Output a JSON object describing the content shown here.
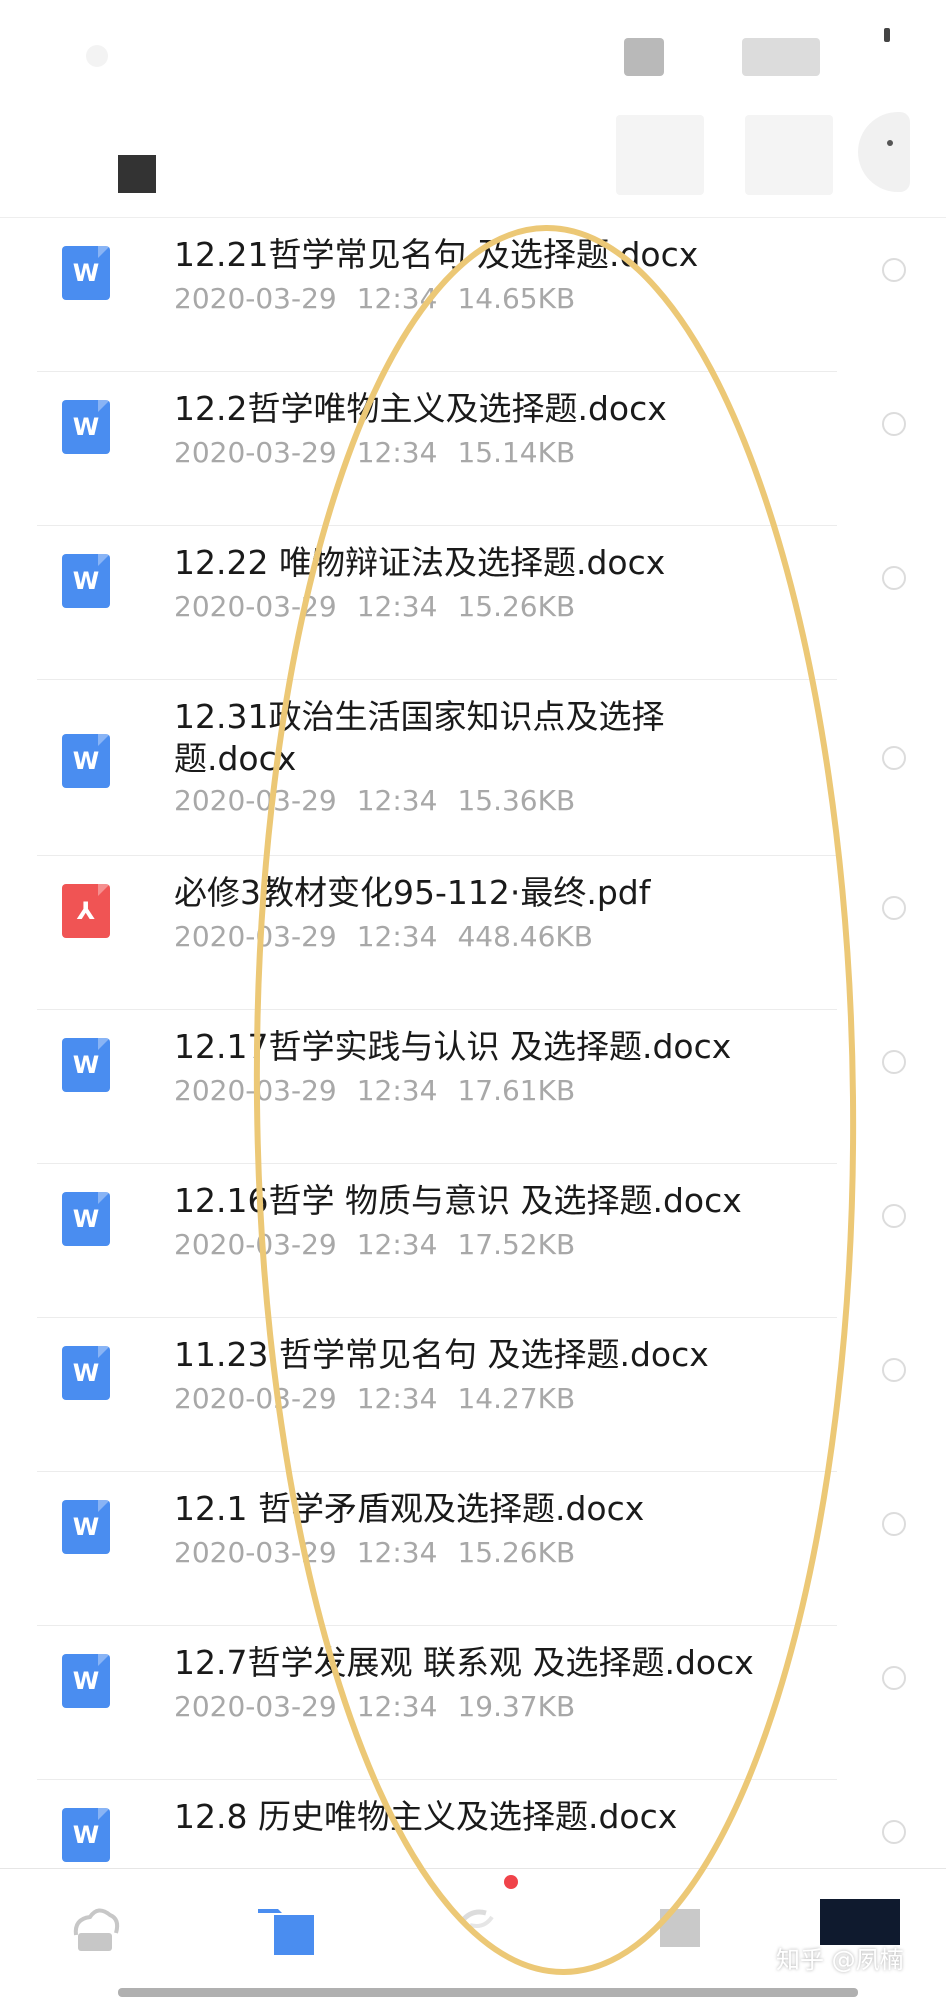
{
  "colors": {
    "docx_icon": "#4a8df0",
    "pdf_icon": "#f05454",
    "file_name": "#1a1a1a",
    "file_meta": "#a8a8a8",
    "highlight": "#ecc876",
    "tab_active": "#4a8df0",
    "badge": "#f0434a"
  },
  "header": {
    "back_icon": "back-icon"
  },
  "files": [
    {
      "name": "12.21哲学常见名句 及选择题.docx",
      "date": "2020-03-29",
      "time": "12:34",
      "size": "14.65KB",
      "type": "docx",
      "icon_glyph": "W"
    },
    {
      "name": "12.2哲学唯物主义及选择题.docx",
      "date": "2020-03-29",
      "time": "12:34",
      "size": "15.14KB",
      "type": "docx",
      "icon_glyph": "W"
    },
    {
      "name": "12.22 唯物辩证法及选择题.docx",
      "date": "2020-03-29",
      "time": "12:34",
      "size": "15.26KB",
      "type": "docx",
      "icon_glyph": "W"
    },
    {
      "name": "12.31政治生活国家知识点及选择题.docx",
      "date": "2020-03-29",
      "time": "12:34",
      "size": "15.36KB",
      "type": "docx",
      "icon_glyph": "W"
    },
    {
      "name": "必修3教材变化95-112·最终.pdf",
      "date": "2020-03-29",
      "time": "12:34",
      "size": "448.46KB",
      "type": "pdf",
      "icon_glyph": "⅄"
    },
    {
      "name": "12.17哲学实践与认识 及选择题.docx",
      "date": "2020-03-29",
      "time": "12:34",
      "size": "17.61KB",
      "type": "docx",
      "icon_glyph": "W"
    },
    {
      "name": "12.16哲学 物质与意识 及选择题.docx",
      "date": "2020-03-29",
      "time": "12:34",
      "size": "17.52KB",
      "type": "docx",
      "icon_glyph": "W"
    },
    {
      "name": "11.23 哲学常见名句 及选择题.docx",
      "date": "2020-03-29",
      "time": "12:34",
      "size": "14.27KB",
      "type": "docx",
      "icon_glyph": "W"
    },
    {
      "name": "12.1 哲学矛盾观及选择题.docx",
      "date": "2020-03-29",
      "time": "12:34",
      "size": "15.26KB",
      "type": "docx",
      "icon_glyph": "W"
    },
    {
      "name": "12.7哲学发展观 联系观 及选择题.docx",
      "date": "2020-03-29",
      "time": "12:34",
      "size": "19.37KB",
      "type": "docx",
      "icon_glyph": "W"
    },
    {
      "name": "12.8 历史唯物主义及选择题.docx",
      "date": "",
      "time": "",
      "size": "",
      "type": "docx",
      "icon_glyph": "W"
    }
  ],
  "tab_bar": {
    "tabs": [
      {
        "name": "cloud-icon",
        "active": false
      },
      {
        "name": "files-icon",
        "active": true
      },
      {
        "name": "transfer-icon",
        "active": false
      },
      {
        "name": "share-icon",
        "active": false
      },
      {
        "name": "me-icon",
        "active": false
      }
    ]
  },
  "watermark": "知乎 @夙楠"
}
